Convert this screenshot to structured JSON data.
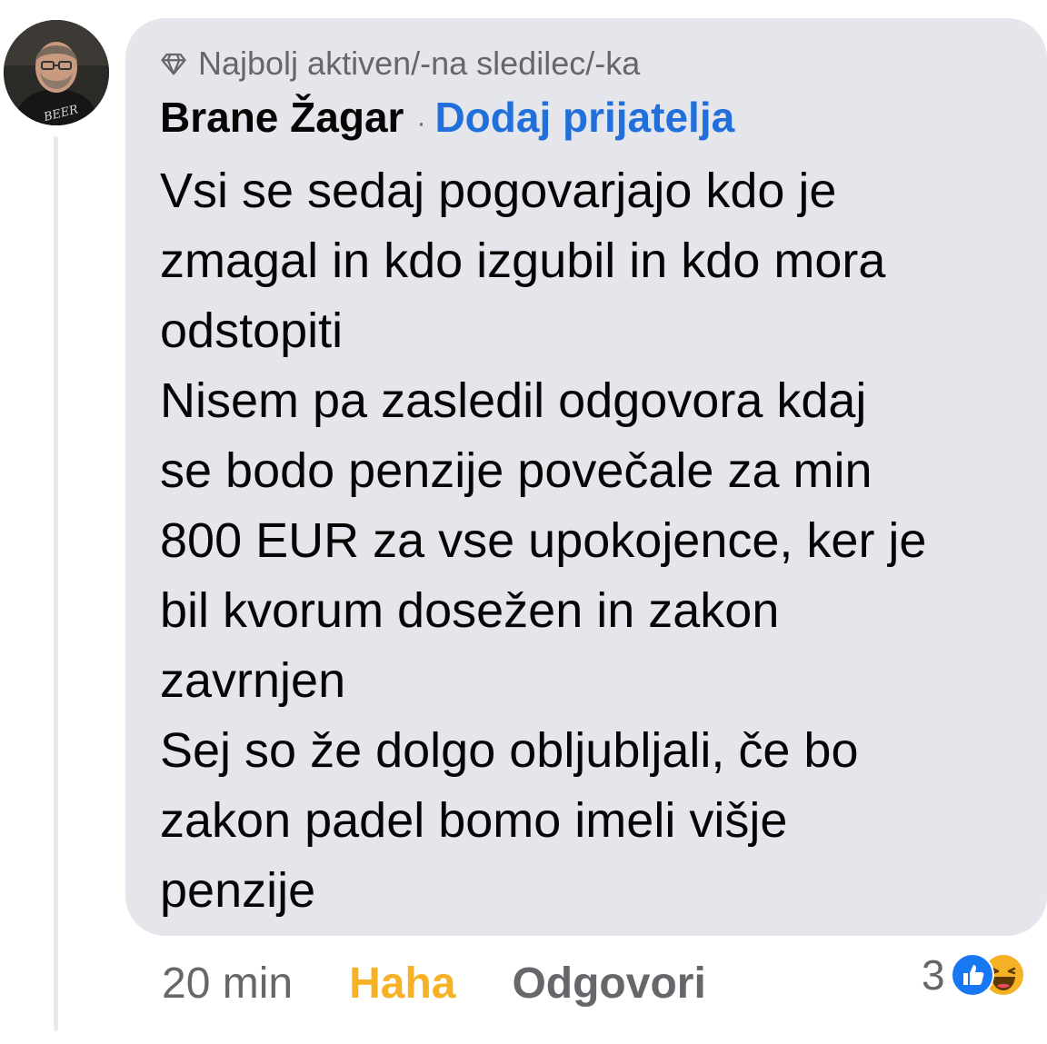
{
  "comment": {
    "badge": "Najbolj aktiven/-na sledilec/-ka",
    "author": "Brane Žagar",
    "separator": "·",
    "add_friend_label": "Dodaj prijatelja",
    "lines": [
      "Vsi se sedaj pogovarjajo kdo je",
      "zmagal in kdo izgubil in kdo mora",
      "odstopiti",
      "Nisem pa zasledil odgovora kdaj",
      "se bodo penzije povečale za min",
      "800 EUR za vse upokojence, ker je",
      "bil kvorum dosežen in zakon",
      "zavrnjen",
      "Sej so že dolgo obljubljali, če bo",
      "zakon padel bomo imeli višje",
      "penzije"
    ],
    "timestamp": "20 min",
    "haha_label": "Haha",
    "reply_label": "Odgovori",
    "reaction_count": "3",
    "reaction_icons": [
      "like-icon",
      "haha-icon"
    ]
  },
  "colors": {
    "bubble": "#e4e6eb",
    "link_blue": "#216fdb",
    "haha_yellow": "#f7b125",
    "muted_text": "#65676b"
  }
}
